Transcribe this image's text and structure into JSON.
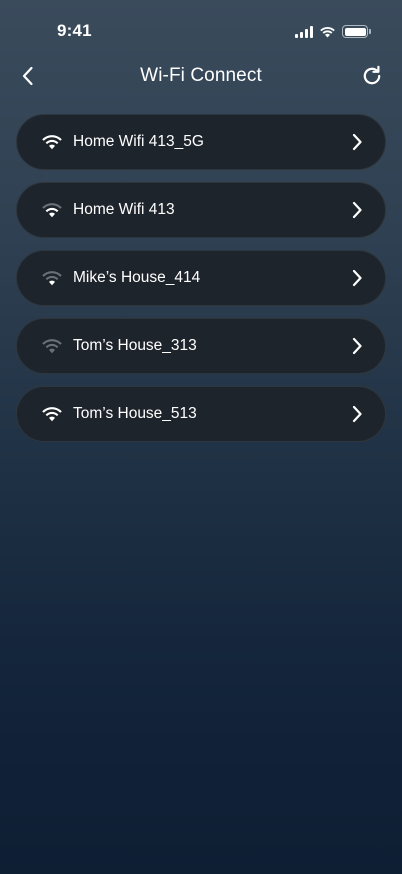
{
  "status_bar": {
    "time": "9:41",
    "battery_level": 1.0
  },
  "nav": {
    "title": "Wi-Fi Connect",
    "back_icon": "chevron-left-icon",
    "refresh_icon": "refresh-icon"
  },
  "networks": [
    {
      "name": "Home Wifi 413_5G",
      "signal_bars": 3
    },
    {
      "name": "Home Wifi 413",
      "signal_bars": 2
    },
    {
      "name": "Mike’s House_414",
      "signal_bars": 1
    },
    {
      "name": "Tom’s House_313",
      "signal_bars": 0
    },
    {
      "name": "Tom’s House_513",
      "signal_bars": 3
    }
  ],
  "colors": {
    "item_bg": "#1e242c",
    "wifi_active": "#ffffff",
    "wifi_dim": "#6b7078"
  }
}
